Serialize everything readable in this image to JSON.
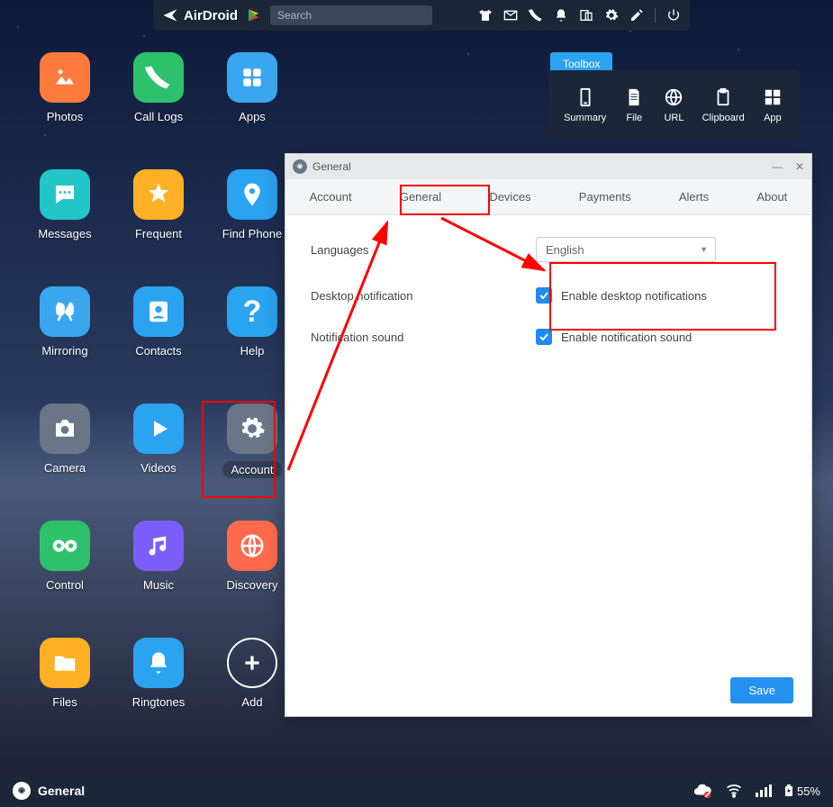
{
  "topbar": {
    "brand": "AirDroid",
    "search_placeholder": "Search"
  },
  "toolbox": {
    "tab": "Toolbox",
    "items": [
      {
        "label": "Summary"
      },
      {
        "label": "File"
      },
      {
        "label": "URL"
      },
      {
        "label": "Clipboard"
      },
      {
        "label": "App"
      }
    ]
  },
  "apps": [
    {
      "label": "Photos",
      "bg": "#ff7a3d"
    },
    {
      "label": "Call Logs",
      "bg": "#2ec16b"
    },
    {
      "label": "Apps",
      "bg": "#3aa6f0"
    },
    {
      "label": "Messages",
      "bg": "#22c6c6"
    },
    {
      "label": "Frequent",
      "bg": "#ffb025"
    },
    {
      "label": "Find Phone",
      "bg": "#2aa3f0"
    },
    {
      "label": "Mirroring",
      "bg": "#3aa6f0"
    },
    {
      "label": "Contacts",
      "bg": "#2aa3f0"
    },
    {
      "label": "Help",
      "bg": "#2aa3f0"
    },
    {
      "label": "Camera",
      "bg": "#6a7587"
    },
    {
      "label": "Videos",
      "bg": "#2aa3f0"
    },
    {
      "label": "Account",
      "bg": "#6a7587",
      "pill": true
    },
    {
      "label": "Control",
      "bg": "#2ec16b"
    },
    {
      "label": "Music",
      "bg": "#7b5dfb"
    },
    {
      "label": "Discovery",
      "bg": "#ff6a4d"
    },
    {
      "label": "Files",
      "bg": "#ffb025"
    },
    {
      "label": "Ringtones",
      "bg": "#2aa3f0"
    },
    {
      "label": "Add",
      "bg": "transparent"
    }
  ],
  "settings": {
    "title": "General",
    "tabs": [
      "Account",
      "General",
      "Devices",
      "Payments",
      "Alerts",
      "About"
    ],
    "rows": {
      "languages_label": "Languages",
      "languages_value": "English",
      "desktop_label": "Desktop notification",
      "desktop_cb": "Enable desktop notifications",
      "sound_label": "Notification sound",
      "sound_cb": "Enable notification sound"
    },
    "save": "Save"
  },
  "bottombar": {
    "label": "General",
    "battery": "55%"
  }
}
